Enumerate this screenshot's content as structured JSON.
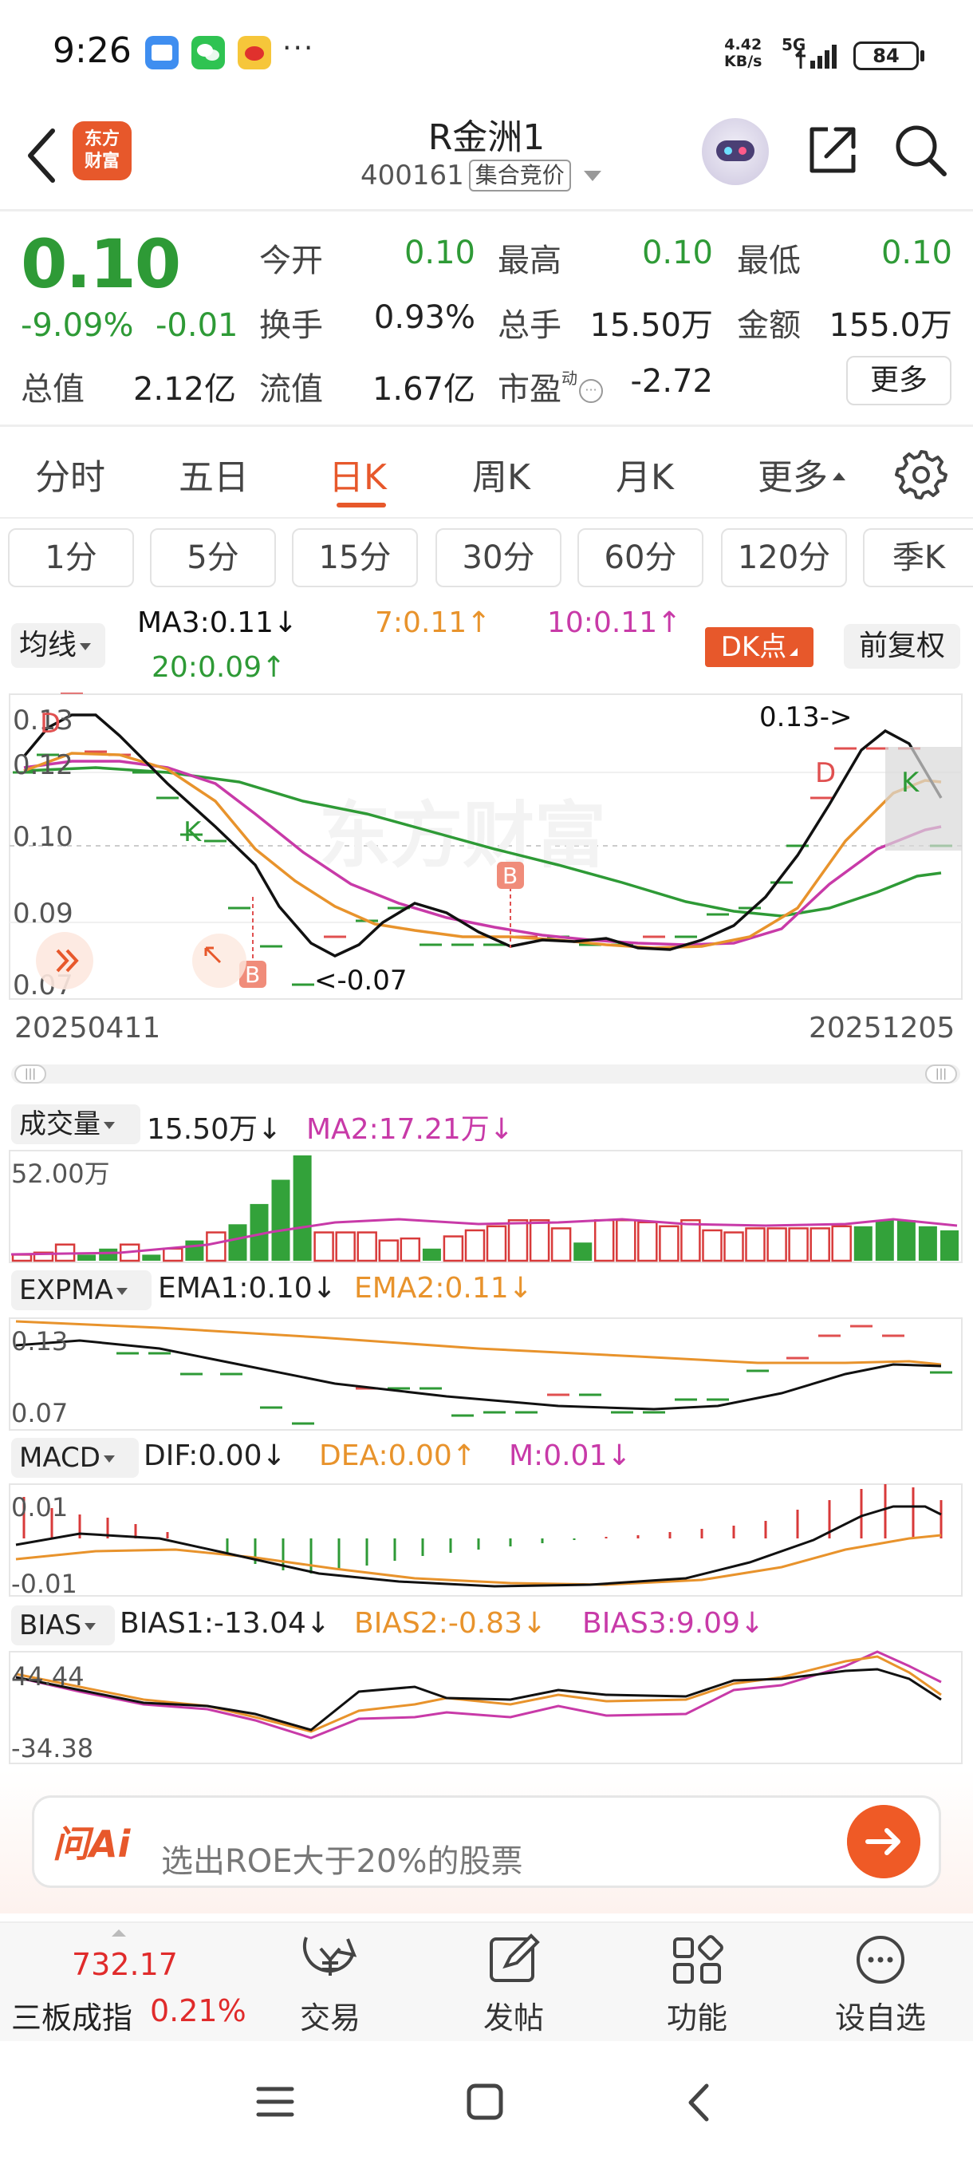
{
  "status_bar": {
    "time": "9:26",
    "net_speed_value": "4.42",
    "net_speed_unit": "KB/s",
    "net_type": "5G",
    "battery": "84",
    "more_apps": "···"
  },
  "header": {
    "logo_text": "东方财富",
    "stock_name": "R金洲1",
    "stock_code": "400161",
    "auction_tag": "集合竞价"
  },
  "quote": {
    "price": "0.10",
    "change_pct": "-9.09%",
    "change_amt": "-0.01",
    "fields": [
      {
        "label": "今开",
        "value": "0.10",
        "color": "#2e9a36"
      },
      {
        "label": "最高",
        "value": "0.10",
        "color": "#2e9a36"
      },
      {
        "label": "最低",
        "value": "0.10",
        "color": "#2e9a36"
      },
      {
        "label": "换手",
        "value": "0.93%",
        "color": "#222222"
      },
      {
        "label": "总手",
        "value": "15.50万",
        "color": "#222222"
      },
      {
        "label": "金额",
        "value": "155.0万",
        "color": "#222222"
      },
      {
        "label": "总值",
        "value": "2.12亿",
        "color": "#222222"
      },
      {
        "label": "流值",
        "value": "1.67亿",
        "color": "#222222"
      },
      {
        "label": "市盈",
        "value": "-2.72",
        "color": "#222222"
      }
    ],
    "pe_superscript": "动",
    "more_button": "更多"
  },
  "period_tabs": [
    "分时",
    "五日",
    "日K",
    "周K",
    "月K",
    "更多"
  ],
  "active_tab": "日K",
  "intervals": [
    "1分",
    "5分",
    "15分",
    "30分",
    "60分",
    "120分",
    "季K"
  ],
  "ma_bar": {
    "selector": "均线",
    "ma3": "MA3:0.11↓",
    "ma7": "7:0.11↑",
    "ma10": "10:0.11↑",
    "ma20": "20:0.09↑",
    "dk_button": "DK点",
    "adjust_button": "前复权"
  },
  "kline": {
    "y_ticks": [
      "0.13",
      "0.12",
      "0.10",
      "0.09",
      "0.07"
    ],
    "start_date": "20250411",
    "end_date": "20251205",
    "annotation_high": "0.13->",
    "annotation_low": "<-0.07",
    "signal_b": "B",
    "signal_k": "K",
    "signal_d": "D",
    "watermark": "东方财富"
  },
  "volume": {
    "selector": "成交量",
    "value": "15.50万↓",
    "ma2": "MA2:17.21万↓",
    "y_max": "52.00万",
    "bars_wan": [
      3,
      4,
      8,
      3,
      6,
      8,
      3,
      6,
      10,
      14,
      18,
      28,
      40,
      52,
      14,
      14,
      14,
      10,
      11,
      6,
      12,
      15,
      17,
      20,
      20,
      16,
      9,
      20,
      20,
      19,
      17,
      20,
      15,
      14,
      16,
      16,
      16,
      16,
      17,
      17,
      20,
      20,
      17,
      15
    ],
    "bars_green": [
      false,
      false,
      false,
      true,
      true,
      false,
      true,
      false,
      true,
      false,
      true,
      true,
      true,
      true,
      false,
      false,
      false,
      false,
      false,
      true,
      false,
      false,
      false,
      false,
      false,
      false,
      true,
      false,
      false,
      false,
      false,
      false,
      false,
      false,
      false,
      false,
      false,
      false,
      false,
      true,
      true,
      true,
      true,
      true
    ]
  },
  "expma": {
    "selector": "EXPMA",
    "ema1": "EMA1:0.10↓",
    "ema2": "EMA2:0.11↓",
    "y_top": "0.13",
    "y_bottom": "0.07"
  },
  "macd": {
    "selector": "MACD",
    "dif": "DIF:0.00↓",
    "dea": "DEA:0.00↑",
    "m": "M:0.01↓",
    "y_top": "0.01",
    "y_bottom": "-0.01"
  },
  "bias": {
    "selector": "BIAS",
    "bias1": "BIAS1:-13.04↓",
    "bias2": "BIAS2:-0.83↓",
    "bias3": "BIAS3:9.09↓",
    "y_top": "44.44",
    "y_bottom": "-34.38"
  },
  "ai_bar": {
    "logo": "问Ai",
    "prompt": "选出ROE大于20%的股票"
  },
  "bottom_bar": {
    "index_value": "732.17",
    "index_name": "三板成指",
    "index_change": "0.21%",
    "items": [
      "交易",
      "发帖",
      "功能",
      "设自选"
    ]
  },
  "colors": {
    "brand": "#e7582b",
    "down": "#2e9a36",
    "up": "#e02b2b",
    "ma3": "#111111",
    "ma7": "#e8932c",
    "ma10": "#c83aa8",
    "ma20": "#2e9a36"
  }
}
